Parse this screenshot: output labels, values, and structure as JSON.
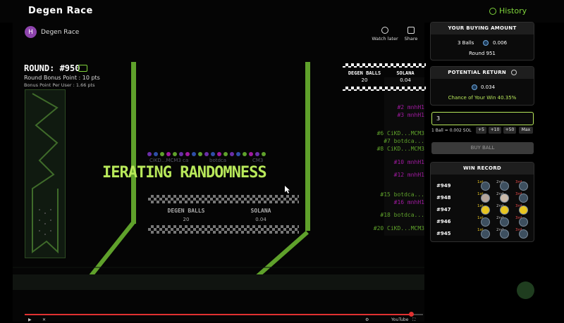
{
  "app": {
    "title": "Degen Race",
    "history_label": "History"
  },
  "video": {
    "channel_initial": "H",
    "channel_name": "Degen Race",
    "watch_later": "Watch later",
    "share": "Share",
    "round_label": "ROUND: #950",
    "round_bonus": "Round Bonus Point : 10 pts",
    "bonus_per_user": "Bonus Point Per User : 1.66 pts",
    "top_stats": {
      "balls_head": "DEGEN BALLS",
      "balls_val": "20",
      "sol_head": "SOLANA",
      "sol_val": "0.04"
    },
    "center_stats": {
      "balls_head": "DEGEN BALLS",
      "balls_val": "20",
      "sol_head": "SOLANA",
      "sol_val": "0.04"
    },
    "generating_text": "IERATING RANDOMNESS",
    "overlap_names": [
      "CiKD...MCM3 ca",
      "botdca",
      "CM3"
    ],
    "rankings": [
      {
        "label": "#2 mnhH1",
        "color": "#a01aa0"
      },
      {
        "label": "#3 mnhH1",
        "color": "#a01aa0"
      },
      {
        "label": "#6 CiKD...MCM3",
        "color": "#5fa12b"
      },
      {
        "label": "#7 botdca...",
        "color": "#5fa12b"
      },
      {
        "label": "#8 CiKD...MCM3",
        "color": "#5fa12b"
      },
      {
        "label": "#10 mnhH1",
        "color": "#a01aa0"
      },
      {
        "label": "#12 mnhH1",
        "color": "#a01aa0"
      },
      {
        "label": "#15 botdca...",
        "color": "#5fa12b"
      },
      {
        "label": "#16 mnhH1",
        "color": "#a01aa0"
      },
      {
        "label": "#18 botdca...",
        "color": "#5fa12b"
      },
      {
        "label": "#20 CiKD...MCM3",
        "color": "#5fa12b"
      }
    ],
    "youtube_label": "YouTube",
    "progress_fraction": 0.97
  },
  "buying": {
    "title": "YOUR BUYING AMOUNT",
    "balls": "3 Balls",
    "amount": "0.006",
    "round": "Round 951"
  },
  "potential": {
    "title": "POTENTIAL RETURN",
    "info_icon": "info-icon",
    "amount": "0.034",
    "chance_label": "Chance of Your Win",
    "chance_value": "40.35%"
  },
  "quantity": {
    "value": "3",
    "price_label": "1 Ball = 0.002 SOL",
    "buttons": [
      "+5",
      "+10",
      "+50",
      "Max"
    ]
  },
  "buy_button": "BUY BALL",
  "win_record": {
    "title": "WIN RECORD",
    "places": [
      "1st",
      "2nd",
      "3rd"
    ],
    "rows": [
      {
        "round": "#949"
      },
      {
        "round": "#948"
      },
      {
        "round": "#947"
      },
      {
        "round": "#946"
      },
      {
        "round": "#945"
      }
    ]
  },
  "colors": {
    "accent": "#b8e85a",
    "green": "#5fa12b",
    "history": "#7fd43b",
    "progress": "#e03131"
  }
}
